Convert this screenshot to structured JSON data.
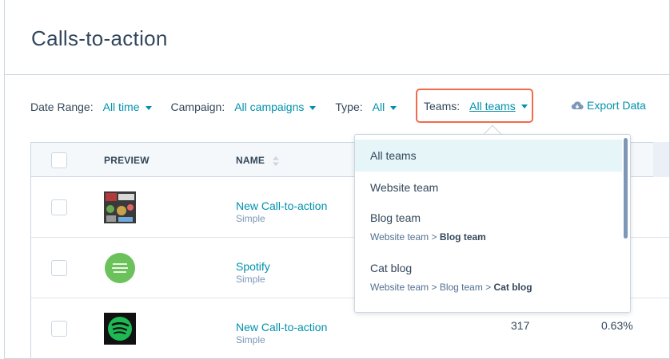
{
  "page": {
    "title": "Calls-to-action"
  },
  "filters": {
    "date_range": {
      "label": "Date Range:",
      "value": "All time"
    },
    "campaign": {
      "label": "Campaign:",
      "value": "All campaigns"
    },
    "type": {
      "label": "Type:",
      "value": "All"
    },
    "teams": {
      "label": "Teams:",
      "value": "All teams"
    },
    "export_label": "Export Data"
  },
  "table": {
    "columns": {
      "preview": "PREVIEW",
      "name": "NAME"
    },
    "rows": [
      {
        "name": "New Call-to-action",
        "type": "Simple",
        "thumb": "collage-image"
      },
      {
        "name": "Spotify",
        "type": "Simple",
        "thumb": "green-circle-image"
      },
      {
        "name": "New Call-to-action",
        "type": "Simple",
        "thumb": "spotify-logo",
        "views": "317",
        "rate": "0.63%"
      }
    ]
  },
  "teams_dropdown": {
    "items": [
      {
        "label": "All teams",
        "selected": true
      },
      {
        "label": "Website team"
      },
      {
        "label": "Blog team",
        "path_prefix": "Website team > ",
        "path_leaf": "Blog team"
      },
      {
        "label": "Cat blog",
        "path_prefix": "Website team > Blog team > ",
        "path_leaf": "Cat blog"
      }
    ]
  },
  "colors": {
    "accent": "#0091ae",
    "highlight": "#f26b4c",
    "text": "#33475b"
  }
}
